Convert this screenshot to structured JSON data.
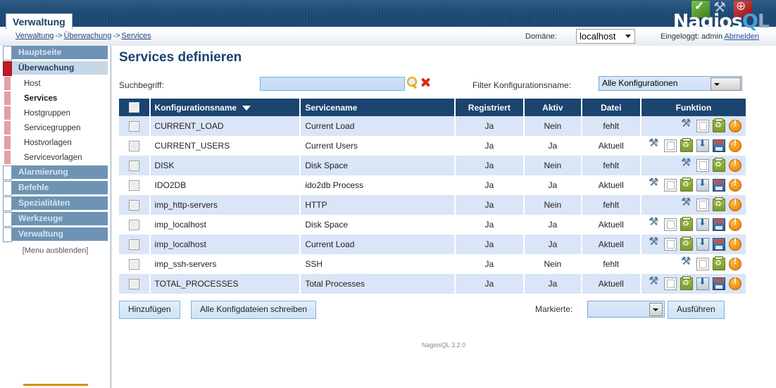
{
  "header": {
    "tab_label": "Verwaltung",
    "logo": {
      "part1": "N",
      "part2": "agios",
      "part3": "Q",
      "part4": "L"
    }
  },
  "subbar": {
    "breadcrumb": [
      "Verwaltung",
      "Überwachung",
      "Services"
    ],
    "breadcrumb_separator": "->",
    "domain_label": "Domäne:",
    "domain_value": "localhost",
    "login_text": "Eingeloggt: admin",
    "logout_label": "Abmelden"
  },
  "sidebar": {
    "items": [
      {
        "label": "Hauptseite",
        "active": false
      },
      {
        "label": "Überwachung",
        "active": true
      }
    ],
    "subitems": [
      {
        "label": "Host",
        "current": false
      },
      {
        "label": "Services",
        "current": true
      },
      {
        "label": "Hostgruppen",
        "current": false
      },
      {
        "label": "Servicegruppen",
        "current": false
      },
      {
        "label": "Hostvorlagen",
        "current": false
      },
      {
        "label": "Servicevorlagen",
        "current": false
      }
    ],
    "items_after": [
      {
        "label": "Alarmierung"
      },
      {
        "label": "Befehle"
      },
      {
        "label": "Spezialitäten"
      },
      {
        "label": "Werkzeuge"
      },
      {
        "label": "Verwaltung"
      }
    ],
    "hide_menu_label": "[Menu ausblenden]"
  },
  "main": {
    "page_title": "Services definieren",
    "search_label": "Suchbegriff:",
    "search_value": "",
    "search_placeholder": "",
    "filter_label": "Filter Konfigurationsname:",
    "filter_value": "Alle Konfigurationen",
    "columns": [
      "Konfigurationsname",
      "Servicename",
      "Registriert",
      "Aktiv",
      "Datei",
      "Funktion"
    ],
    "sorted_column": "Konfigurationsname",
    "rows": [
      {
        "config": "CURRENT_LOAD",
        "service": "Current Load",
        "registriert": "Ja",
        "aktiv": "Nein",
        "datei": "fehlt",
        "icons": [
          "tools-icon",
          "copy-icon",
          "delete-icon",
          "warning-icon"
        ]
      },
      {
        "config": "CURRENT_USERS",
        "service": "Current Users",
        "registriert": "Ja",
        "aktiv": "Ja",
        "datei": "Aktuell",
        "icons": [
          "tools-icon",
          "copy-icon",
          "delete-icon",
          "import-icon",
          "save-icon",
          "warning-icon"
        ]
      },
      {
        "config": "DISK",
        "service": "Disk Space",
        "registriert": "Ja",
        "aktiv": "Nein",
        "datei": "fehlt",
        "icons": [
          "tools-icon",
          "copy-icon",
          "delete-icon",
          "warning-icon"
        ]
      },
      {
        "config": "IDO2DB",
        "service": "ido2db Process",
        "registriert": "Ja",
        "aktiv": "Ja",
        "datei": "Aktuell",
        "icons": [
          "tools-icon",
          "copy-icon",
          "delete-icon",
          "import-icon",
          "save-icon",
          "warning-icon"
        ]
      },
      {
        "config": "imp_http-servers",
        "service": "HTTP",
        "registriert": "Ja",
        "aktiv": "Nein",
        "datei": "fehlt",
        "icons": [
          "tools-icon",
          "copy-icon",
          "delete-icon",
          "warning-icon"
        ]
      },
      {
        "config": "imp_localhost",
        "service": "Disk Space",
        "registriert": "Ja",
        "aktiv": "Ja",
        "datei": "Aktuell",
        "icons": [
          "tools-icon",
          "copy-icon",
          "delete-icon",
          "import-icon",
          "save-icon",
          "warning-icon"
        ]
      },
      {
        "config": "imp_localhost",
        "service": "Current Load",
        "registriert": "Ja",
        "aktiv": "Ja",
        "datei": "Aktuell",
        "icons": [
          "tools-icon",
          "copy-icon",
          "delete-icon",
          "import-icon",
          "save-icon",
          "warning-icon"
        ]
      },
      {
        "config": "imp_ssh-servers",
        "service": "SSH",
        "registriert": "Ja",
        "aktiv": "Nein",
        "datei": "fehlt",
        "icons": [
          "tools-icon",
          "copy-icon",
          "delete-icon",
          "warning-icon"
        ]
      },
      {
        "config": "TOTAL_PROCESSES",
        "service": "Total Processes",
        "registriert": "Ja",
        "aktiv": "Ja",
        "datei": "Aktuell",
        "icons": [
          "tools-icon",
          "copy-icon",
          "delete-icon",
          "import-icon",
          "save-icon",
          "warning-icon"
        ]
      }
    ],
    "add_label": "Hinzufügen",
    "write_all_label": "Alle Konfigdateien schreiben",
    "marked_label": "Markierte:",
    "marked_value": "",
    "execute_label": "Ausführen",
    "footer": "NagiosQL 3.2.0"
  },
  "colors": {
    "header_blue": "#1b4470",
    "row_odd": "#dae5f7",
    "status_missing": "#1e8c1e",
    "accent_orange": "#e08a14"
  }
}
